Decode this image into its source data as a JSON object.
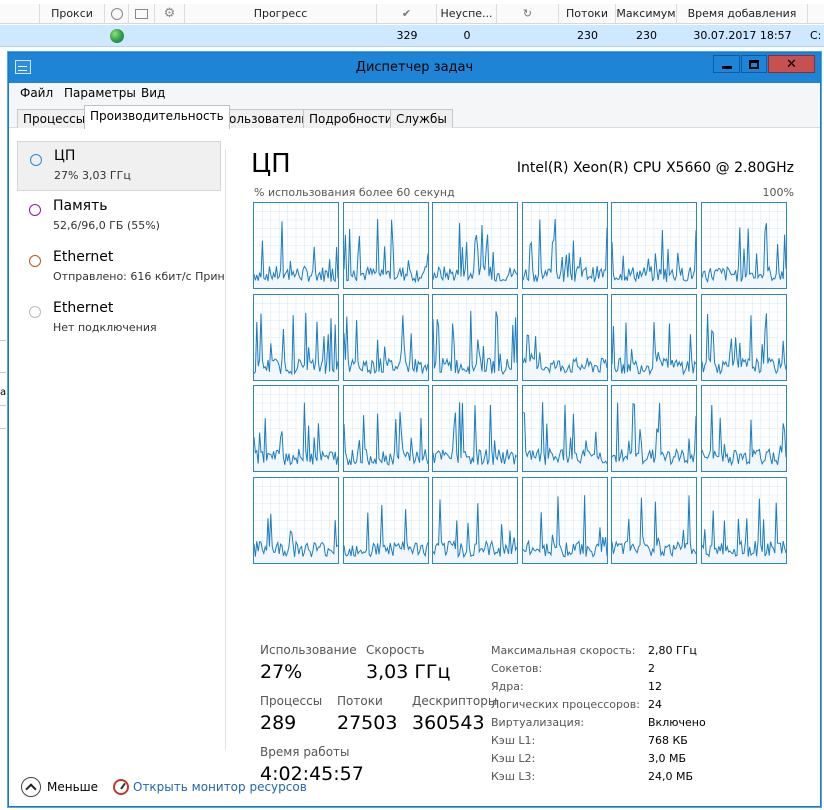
{
  "background": {
    "columns": [
      "Прокси",
      "",
      "",
      "",
      "Прогресс",
      "✔",
      "Неуспе...",
      "↻",
      "Потоки",
      "Максимум",
      "Время добавления",
      ""
    ],
    "row": {
      "progress": "",
      "success": "329",
      "failed": "0",
      "threads": "230",
      "max": "230",
      "added": "30.07.2017 18:57",
      "extra": "C:"
    },
    "edge_fragment": "а"
  },
  "window": {
    "title": "Диспетчер задач",
    "close_glyph": "✕"
  },
  "menu": [
    "Файл",
    "Параметры",
    "Вид"
  ],
  "tabs": [
    "Процессы",
    "Производительность",
    "Пользователи",
    "Подробности",
    "Службы"
  ],
  "sidebar": {
    "items": [
      {
        "title": "ЦП",
        "sub": "27% 3,03 ГГц",
        "color": "#1b8fd6"
      },
      {
        "title": "Память",
        "sub": "52,6/96,0 ГБ (55%)",
        "color": "#8a1aa6"
      },
      {
        "title": "Ethernet",
        "sub": "Отправлено: 616 кбит/с Приня",
        "color": "#b45a1a"
      },
      {
        "title": "Ethernet",
        "sub": "Нет подключения",
        "color": "#bbbbbb"
      }
    ]
  },
  "cpu": {
    "title": "ЦП",
    "model": "Intel(R) Xeon(R) CPU X5660 @ 2.80GHz",
    "graph_caption": "% использования более 60 секунд",
    "graph_max": "100%",
    "core_count": 24,
    "line_color": "#1b7cc0",
    "grid_color": "#d9eaf7",
    "stats": {
      "usage_label": "Использование",
      "usage": "27%",
      "speed_label": "Скорость",
      "speed": "3,03 ГГц",
      "processes_label": "Процессы",
      "processes": "289",
      "threads_label": "Потоки",
      "threads": "27503",
      "handles_label": "Дескрипторы",
      "handles": "360543",
      "uptime_label": "Время работы",
      "uptime": "4:02:45:57"
    },
    "specs": [
      {
        "label": "Максимальная скорость:",
        "value": "2,80 ГГц"
      },
      {
        "label": "Сокетов:",
        "value": "2"
      },
      {
        "label": "Ядра:",
        "value": "12"
      },
      {
        "label": "Логических процессоров:",
        "value": "24"
      },
      {
        "label": "Виртуализация:",
        "value": "Включено"
      },
      {
        "label": "Кэш L1:",
        "value": "768 КБ"
      },
      {
        "label": "Кэш L2:",
        "value": "3,0 МБ"
      },
      {
        "label": "Кэш L3:",
        "value": "24,0 МБ"
      }
    ]
  },
  "footer": {
    "fewer": "Меньше",
    "monitor": "Открыть монитор ресурсов"
  }
}
